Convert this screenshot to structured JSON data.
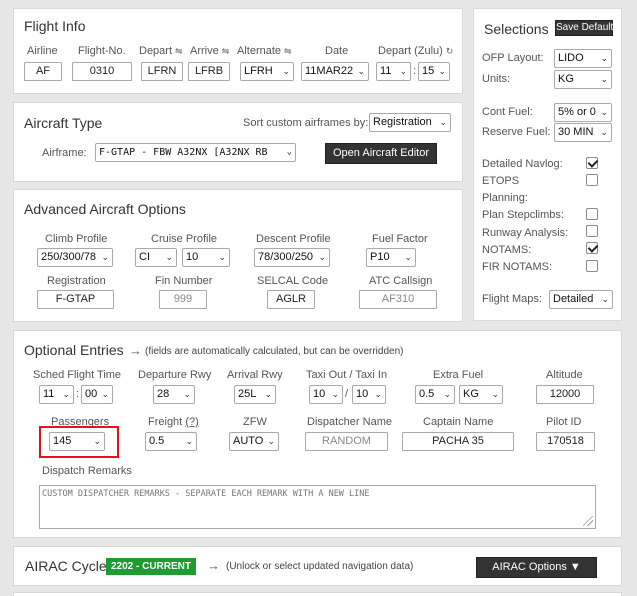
{
  "flight_info": {
    "title": "Flight Info",
    "labels": {
      "airline": "Airline",
      "flight_no": "Flight-No.",
      "depart": "Depart",
      "arrive": "Arrive",
      "alternate": "Alternate",
      "date": "Date",
      "depart_zulu": "Depart (Zulu)"
    },
    "values": {
      "airline": "AF",
      "flight_no": "0310",
      "depart": "LFRN",
      "arrive": "LFRB",
      "alternate": "LFRH",
      "date": "11MAR22",
      "dep_hour": "11",
      "dep_min": "15"
    }
  },
  "selections": {
    "title": "Selections",
    "save_default": "Save Default",
    "ofp_layout_label": "OFP Layout:",
    "ofp_layout": "LIDO",
    "units_label": "Units:",
    "units": "KG",
    "cont_fuel_label": "Cont Fuel:",
    "cont_fuel": "5% or 0",
    "reserve_fuel_label": "Reserve Fuel:",
    "reserve_fuel": "30 MIN",
    "detailed_navlog_label": "Detailed Navlog:",
    "detailed_navlog": true,
    "etops_label": "ETOPS",
    "planning_label": "Planning:",
    "etops": false,
    "plan_stepclimbs_label": "Plan Stepclimbs:",
    "plan_stepclimbs": false,
    "runway_analysis_label": "Runway Analysis:",
    "runway_analysis": false,
    "notams_label": "NOTAMS:",
    "notams": true,
    "fir_notams_label": "FIR NOTAMS:",
    "fir_notams": false,
    "flight_maps_label": "Flight Maps:",
    "flight_maps": "Detailed"
  },
  "aircraft_type": {
    "title": "Aircraft Type",
    "sort_label": "Sort custom airframes by:",
    "sort_value": "Registration",
    "airframe_label": "Airframe:",
    "airframe_value": "F-GTAP - FBW A32NX [A32NX RB",
    "open_editor": "Open Aircraft Editor"
  },
  "advanced": {
    "title": "Advanced Aircraft Options",
    "climb_label": "Climb Profile",
    "climb": "250/300/78",
    "cruise_label": "Cruise Profile",
    "cruise_mode": "CI",
    "cruise_value": "10",
    "descent_label": "Descent Profile",
    "descent": "78/300/250",
    "fuel_factor_label": "Fuel Factor",
    "fuel_factor": "P10",
    "registration_label": "Registration",
    "registration": "F-GTAP",
    "fin_label": "Fin Number",
    "fin_placeholder": "999",
    "selcal_label": "SELCAL Code",
    "selcal": "AGLR",
    "atc_label": "ATC Callsign",
    "atc_placeholder": "AF310"
  },
  "optional": {
    "title": "Optional Entries",
    "arrow": "→",
    "note": "(fields are automatically calculated, but can be overridden)",
    "sched_label": "Sched Flight Time",
    "sched_h": "11",
    "sched_m": "00",
    "dep_rwy_label": "Departure Rwy",
    "dep_rwy": "28",
    "arr_rwy_label": "Arrival Rwy",
    "arr_rwy": "25L",
    "taxi_label": "Taxi Out / Taxi In",
    "taxi_out": "10",
    "taxi_sep": "/",
    "taxi_in": "10",
    "extra_fuel_label": "Extra Fuel",
    "extra_fuel": "0.5",
    "extra_unit": "KG",
    "altitude_label": "Altitude",
    "altitude": "12000",
    "pax_label": "Passengers",
    "pax": "145",
    "freight_label": "Freight",
    "freight_help": "(?)",
    "freight": "0.5",
    "zfw_label": "ZFW",
    "zfw": "AUTO",
    "dispatcher_label": "Dispatcher Name",
    "dispatcher_placeholder": "RANDOM",
    "captain_label": "Captain Name",
    "captain": "PACHA 35",
    "pilot_id_label": "Pilot ID",
    "pilot_id": "170518",
    "remarks_label": "Dispatch Remarks",
    "remarks_placeholder": "CUSTOM DISPATCHER REMARKS - SEPARATE EACH REMARK WITH A NEW LINE"
  },
  "airac": {
    "title": "AIRAC Cycle",
    "badge": "2202 - CURRENT",
    "arrow": "→",
    "note": "(Unlock or select updated navigation data)",
    "options": "AIRAC Options ▼"
  },
  "colors": {
    "badge_green": "#1e9c32",
    "highlight_red": "#e0141b",
    "dark_button": "#333333"
  }
}
